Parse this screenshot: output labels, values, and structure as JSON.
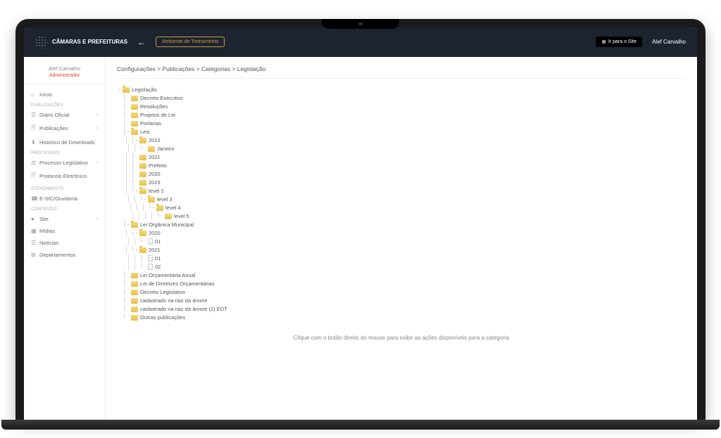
{
  "topbar": {
    "logo_text": "CÂMARAS E PREFEITURAS",
    "env_badge": "Ambiente de Treinamento",
    "goto_site": "Ir para o Site",
    "user": "Alef Carvalho"
  },
  "sidebar": {
    "user_name": "Alef Carvalho",
    "user_role": "Administrador",
    "items": [
      {
        "type": "item",
        "icon": "⌂",
        "label": "Início",
        "expand": false
      },
      {
        "type": "section",
        "label": "Publicações"
      },
      {
        "type": "item",
        "icon": "☰",
        "label": "Diário Oficial",
        "expand": true
      },
      {
        "type": "item",
        "icon": "🗎",
        "label": "Publicações",
        "expand": true
      },
      {
        "type": "item",
        "icon": "⬇",
        "label": "Histórico de Downloads",
        "expand": false
      },
      {
        "type": "section",
        "label": "Processos"
      },
      {
        "type": "item",
        "icon": "⚖",
        "label": "Processo Legislativo",
        "expand": true
      },
      {
        "type": "item",
        "icon": "🗎",
        "label": "Protocolo Eletrônico",
        "expand": false
      },
      {
        "type": "section",
        "label": "Atendimento"
      },
      {
        "type": "item",
        "icon": "☎",
        "label": "E-SIC/Ouvidoria",
        "expand": false
      },
      {
        "type": "section",
        "label": "Conteúdo"
      },
      {
        "type": "item",
        "icon": "●",
        "label": "Site",
        "expand": true
      },
      {
        "type": "item",
        "icon": "▦",
        "label": "Mídias",
        "expand": false
      },
      {
        "type": "item",
        "icon": "☰",
        "label": "Notícias",
        "expand": false
      },
      {
        "type": "item",
        "icon": "⊞",
        "label": "Departamentos",
        "expand": false
      }
    ]
  },
  "breadcrumb": {
    "parts": [
      "Configurações",
      "Publicações",
      "Categorias",
      "Legislação"
    ],
    "sep": " > "
  },
  "tree": [
    {
      "depth": 0,
      "expand": "-",
      "folder": "open",
      "label": "Legislação"
    },
    {
      "depth": 1,
      "expand": "",
      "folder": "closed",
      "label": "Decreto Executivo"
    },
    {
      "depth": 1,
      "expand": "",
      "folder": "closed",
      "label": "Resoluções"
    },
    {
      "depth": 1,
      "expand": "",
      "folder": "closed",
      "label": "Projetos de Lei"
    },
    {
      "depth": 1,
      "expand": "",
      "folder": "closed",
      "label": "Portarias"
    },
    {
      "depth": 1,
      "expand": "-",
      "folder": "open",
      "label": "Leis"
    },
    {
      "depth": 2,
      "expand": "-",
      "folder": "open",
      "label": "2022"
    },
    {
      "depth": 3,
      "expand": "",
      "folder": "closed",
      "label": "Janeiro",
      "last": true
    },
    {
      "depth": 2,
      "expand": "",
      "folder": "closed",
      "label": "2021"
    },
    {
      "depth": 2,
      "expand": "",
      "folder": "closed",
      "label": "Prefeito"
    },
    {
      "depth": 2,
      "expand": "",
      "folder": "closed",
      "label": "2020"
    },
    {
      "depth": 2,
      "expand": "",
      "folder": "closed",
      "label": "2023"
    },
    {
      "depth": 2,
      "expand": "-",
      "folder": "open",
      "label": "level 2",
      "last": true
    },
    {
      "depth": 3,
      "expand": "-",
      "folder": "open",
      "label": "level 3",
      "last": true
    },
    {
      "depth": 4,
      "expand": "-",
      "folder": "open",
      "label": "level 4",
      "last": true
    },
    {
      "depth": 5,
      "expand": "",
      "folder": "closed",
      "label": "level 5",
      "last": true
    },
    {
      "depth": 1,
      "expand": "-",
      "folder": "open",
      "label": "Lei Orgânica Municipal"
    },
    {
      "depth": 2,
      "expand": "-",
      "folder": "open",
      "label": "2020"
    },
    {
      "depth": 3,
      "expand": "",
      "folder": "page",
      "label": "01",
      "last": true
    },
    {
      "depth": 2,
      "expand": "-",
      "folder": "open",
      "label": "2021",
      "last": true
    },
    {
      "depth": 3,
      "expand": "",
      "folder": "page",
      "label": "01"
    },
    {
      "depth": 3,
      "expand": "",
      "folder": "page",
      "label": "02",
      "last": true
    },
    {
      "depth": 1,
      "expand": "",
      "folder": "closed",
      "label": "Lei Orçamentária Anual"
    },
    {
      "depth": 1,
      "expand": "",
      "folder": "closed",
      "label": "Lei de Diretrizes Orçamentárias"
    },
    {
      "depth": 1,
      "expand": "",
      "folder": "closed",
      "label": "Decreto Legislativo"
    },
    {
      "depth": 1,
      "expand": "",
      "folder": "closed",
      "label": "cadastrado na raiz da árvore"
    },
    {
      "depth": 1,
      "expand": "",
      "folder": "closed",
      "label": "cadastrado na raiz da árvore (2) EDT"
    },
    {
      "depth": 1,
      "expand": "",
      "folder": "closed",
      "label": "Outras publicações",
      "last": true
    }
  ],
  "help_text": "Clique com o botão direito do mouse para exibir as ações disponíveis para a categoria"
}
